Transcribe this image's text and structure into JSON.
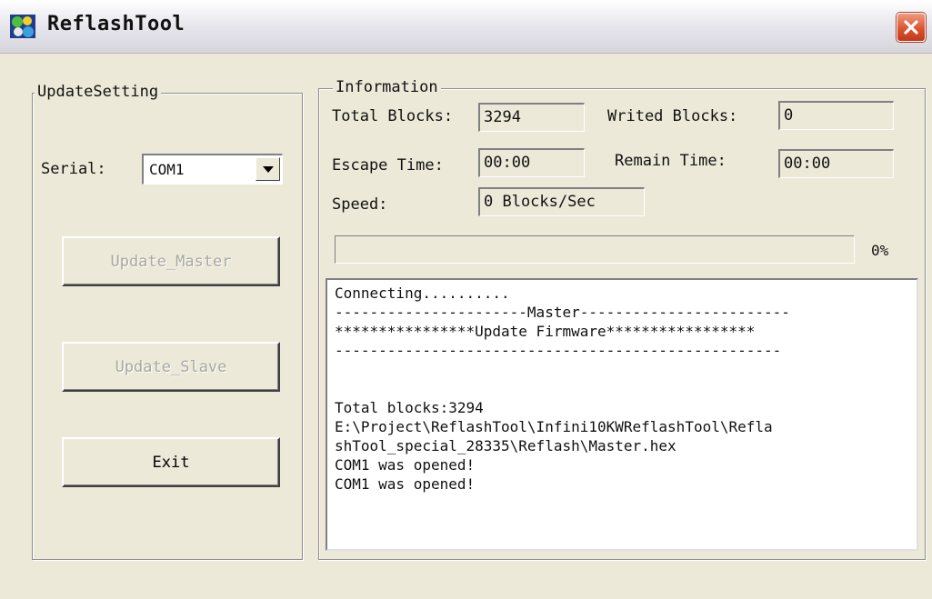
{
  "window": {
    "title": "ReflashTool",
    "icon": "reflash-app-icon",
    "close_icon": "close-icon"
  },
  "update_setting": {
    "group_label": "UpdateSetting",
    "serial_label": "Serial:",
    "serial_value": "COM1",
    "buttons": {
      "update_master": "Update_Master",
      "update_slave": "Update_Slave",
      "exit": "Exit"
    }
  },
  "information": {
    "group_label": "Information",
    "total_blocks_label": "Total Blocks:",
    "total_blocks_value": "3294",
    "writed_blocks_label": "Writed Blocks:",
    "writed_blocks_value": "0",
    "escape_time_label": "Escape Time:",
    "escape_time_value": "00:00",
    "remain_time_label": "Remain Time:",
    "remain_time_value": "00:00",
    "speed_label": "Speed:",
    "speed_value": "0 Blocks/Sec",
    "progress_percent": 0,
    "progress_text": "0%"
  },
  "log": {
    "lines": [
      "Connecting..........",
      "----------------------Master------------------------",
      "****************Update Firmware*****************",
      "---------------------------------------------------",
      "",
      "",
      "Total blocks:3294",
      "E:\\Project\\ReflashTool\\Infini10KWReflashTool\\Refla",
      "shTool_special_28335\\Reflash\\Master.hex",
      "COM1 was opened!",
      "COM1 was opened!"
    ]
  },
  "colors": {
    "window_bg": "#ece9d8",
    "progress_fill": "#2a62c9",
    "close_button": "#d9502c"
  }
}
